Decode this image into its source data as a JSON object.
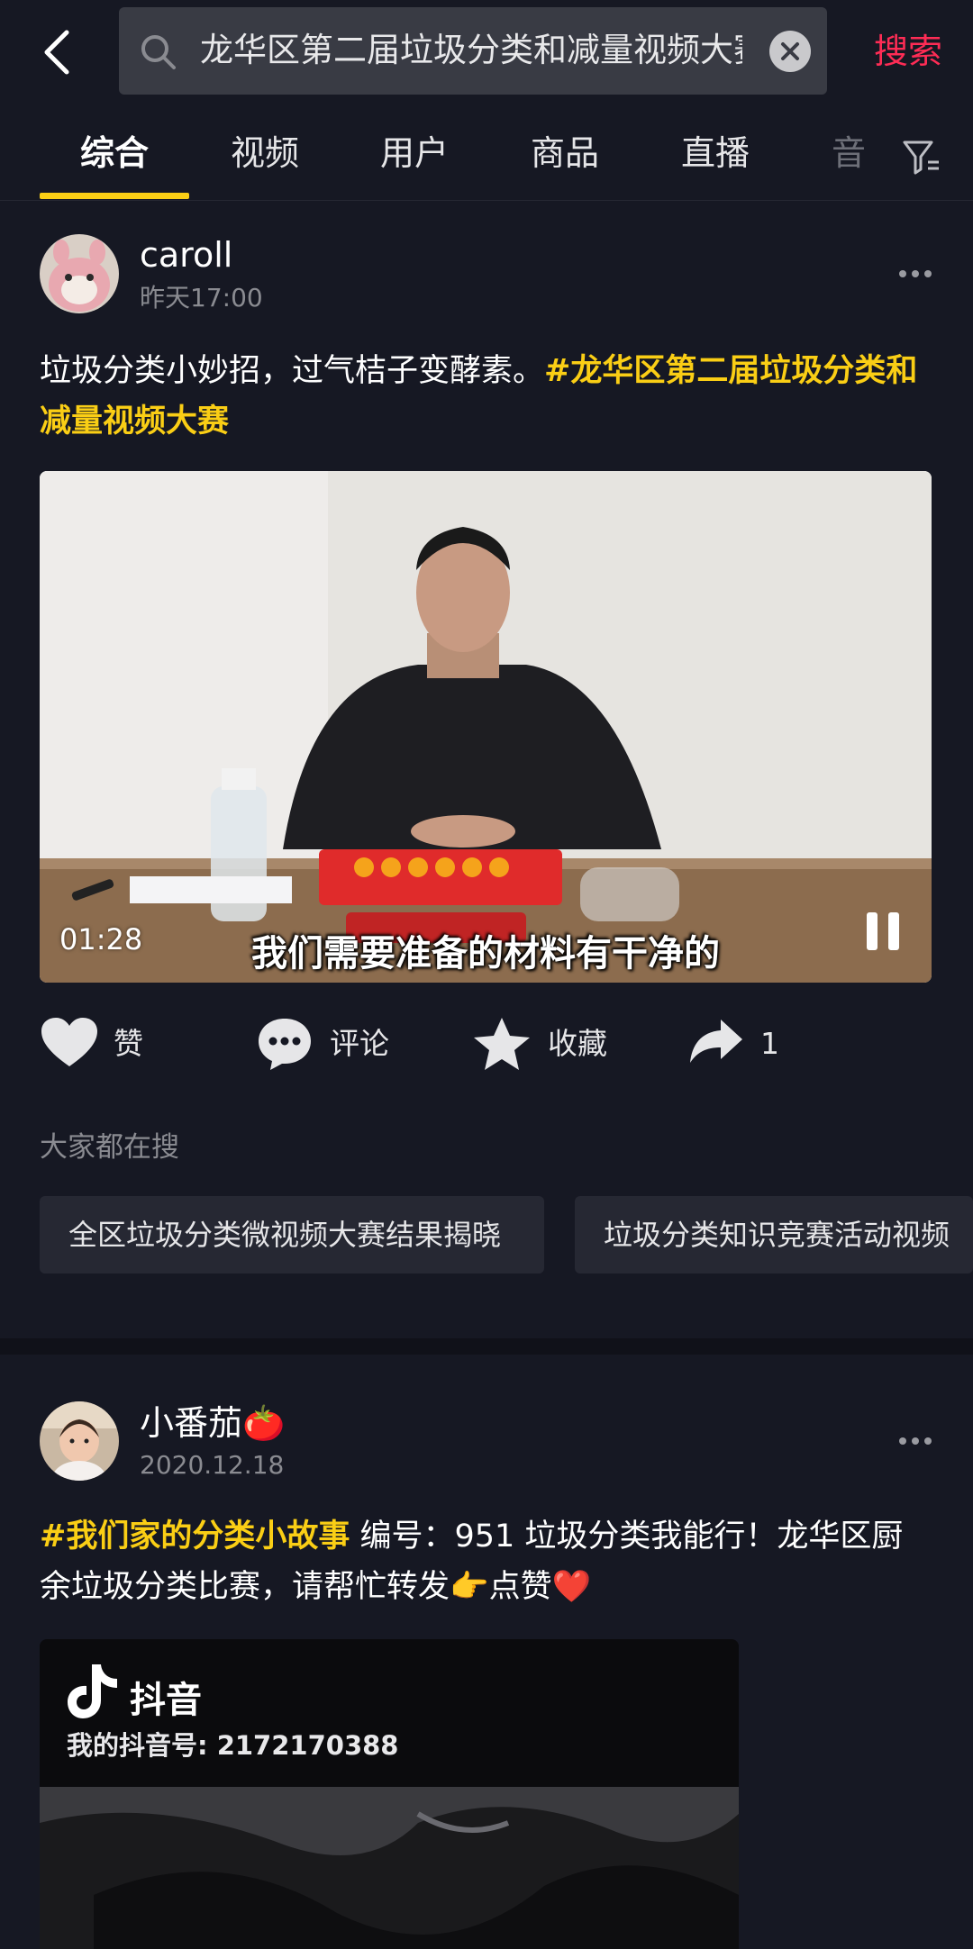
{
  "header": {
    "back_icon": "chevron-left-icon",
    "search_query": "龙华区第二届垃圾分类和减量视频大赛",
    "search_button": "搜索"
  },
  "tabs": [
    "综合",
    "视频",
    "用户",
    "商品",
    "直播",
    "音"
  ],
  "active_tab": "综合",
  "posts": [
    {
      "username": "caroll",
      "time": "昨天17:00",
      "caption_text": "垃圾分类小妙招，过气桔子变酵素。",
      "caption_hashtag": "#龙华区第二届垃圾分类和减量视频大赛",
      "video": {
        "duration": "01:28",
        "subtitle": "我们需要准备的材料有干净的"
      },
      "actions": {
        "like": "赞",
        "comment": "评论",
        "favorite": "收藏",
        "share_count": "1"
      }
    },
    {
      "username": "小番茄🍅",
      "time": "2020.12.18",
      "caption_hashtag": "#我们家的分类小故事",
      "caption_text": " 编号：951 垃圾分类我能行！龙华区厨余垃圾分类比赛，请帮忙转发👉点赞❤️",
      "thumbnail": {
        "brand": "抖音",
        "account_id": "我的抖音号: 2172170388"
      }
    }
  ],
  "related_searches": {
    "title": "大家都在搜",
    "items": [
      "全区垃圾分类微视频大赛结果揭晓",
      "垃圾分类知识竞赛活动视频"
    ]
  },
  "colors": {
    "background": "#161823",
    "accent_yellow": "#face15",
    "accent_red": "#fe2c55"
  }
}
